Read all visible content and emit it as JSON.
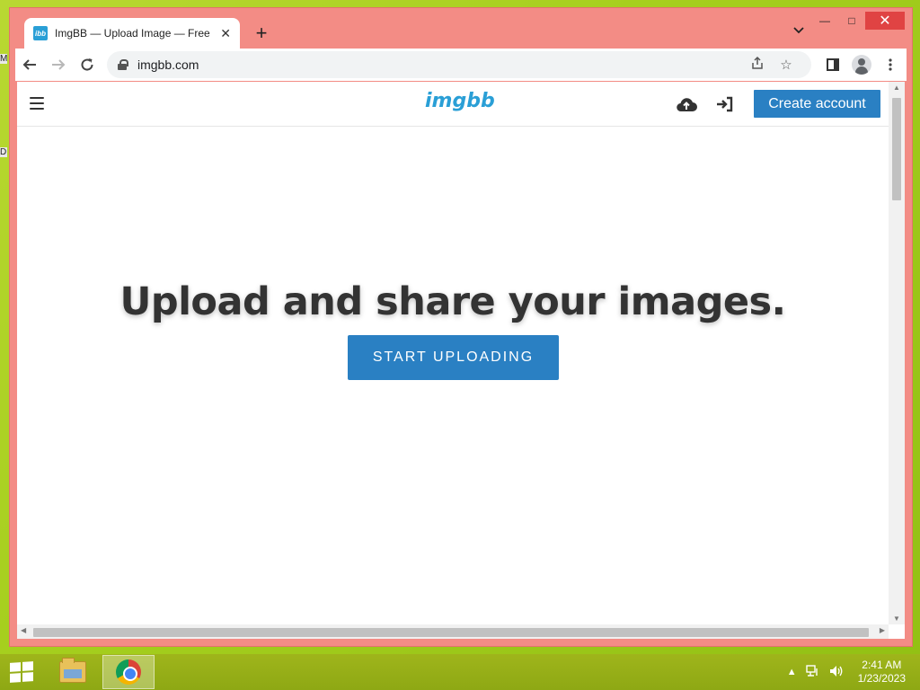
{
  "desktop": {
    "edge_fragments": [
      "M",
      "D"
    ]
  },
  "window": {
    "tab_title": "ImgBB — Upload Image — Free",
    "tab_favicon_text": "ibb",
    "new_tab_symbol": "+",
    "controls": {
      "minimize": "—",
      "maximize": "□",
      "close": "✕"
    }
  },
  "toolbar": {
    "url": "imgbb.com"
  },
  "site": {
    "logo": "imgbb",
    "create_account_label": "Create account",
    "hero_title": "Upload and share your images.",
    "start_uploading_label": "START UPLOADING"
  },
  "taskbar": {
    "time": "2:41 AM",
    "date": "1/23/2023"
  },
  "colors": {
    "primary_button": "#2a80c3",
    "logo": "#2a9fd6",
    "window_frame": "#f38c85",
    "desktop": "#a6cf1e"
  }
}
